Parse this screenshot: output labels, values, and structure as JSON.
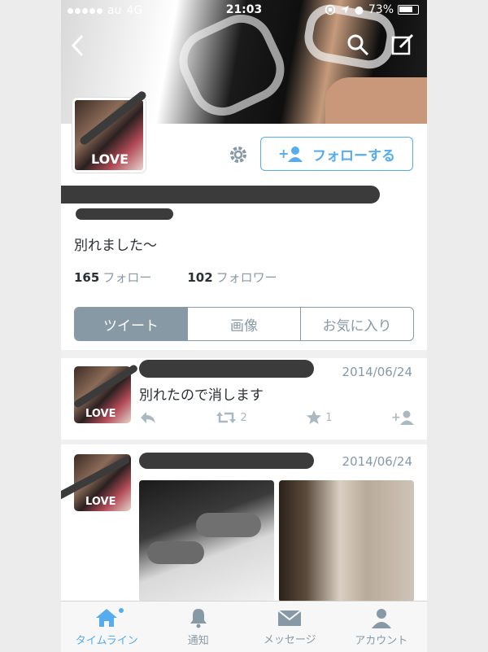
{
  "status_bar": {
    "carrier": "au",
    "network": "4G",
    "time": "21:03",
    "battery": "73%"
  },
  "profile": {
    "bio": "別れました〜",
    "follow_button_label": "フォローする",
    "following_count": "165",
    "following_label": "フォロー",
    "followers_count": "102",
    "followers_label": "フォロワー"
  },
  "tabs": [
    {
      "label": "ツイート",
      "active": true
    },
    {
      "label": "画像",
      "active": false
    },
    {
      "label": "お気に入り",
      "active": false
    }
  ],
  "tweets": [
    {
      "date": "2014/06/24",
      "text": "別れたので消します",
      "retweets": "2",
      "favorites": "1"
    },
    {
      "date": "2014/06/24",
      "text": ""
    }
  ],
  "tabbar": [
    {
      "label": "タイムライン",
      "icon": "home-icon",
      "active": true
    },
    {
      "label": "通知",
      "icon": "bell-icon",
      "active": false
    },
    {
      "label": "メッセージ",
      "icon": "envelope-icon",
      "active": false
    },
    {
      "label": "アカウント",
      "icon": "person-icon",
      "active": false
    }
  ],
  "colors": {
    "accent": "#55acee",
    "muted": "#8899a6",
    "text": "#292f33"
  }
}
